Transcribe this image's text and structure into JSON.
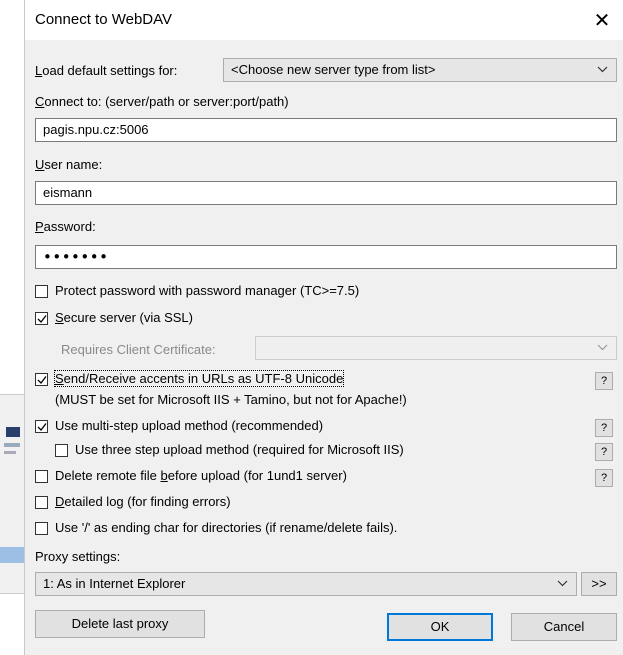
{
  "window": {
    "title": "Connect to WebDAV",
    "close_glyph": "✕"
  },
  "load_defaults": {
    "label_underlined": "L",
    "label_rest": "oad default settings for:",
    "value": "<Choose new server type from list>"
  },
  "connect": {
    "label_underlined": "C",
    "label_rest": "onnect to: (server/path or server:port/path)",
    "value": "pagis.npu.cz:5006"
  },
  "user": {
    "label_underlined": "U",
    "label_rest": "ser name:",
    "value": "eismann"
  },
  "password": {
    "label_underlined": "P",
    "label_rest": "assword:",
    "value": "•••••••"
  },
  "options": {
    "protect_password": {
      "label": "Protect password with password manager (TC>=7.5)",
      "checked": false
    },
    "secure_server": {
      "label_underlined": "S",
      "label_rest": "ecure server (via SSL)",
      "checked": true
    },
    "client_cert": {
      "label": "Requires Client Certificate:",
      "value": ""
    },
    "utf8": {
      "label_underlined": "S",
      "label_rest": "end/Receive accents in URLs as UTF-8 Unicode",
      "note": "(MUST be set for Microsoft IIS + Tamino, but not for Apache!)",
      "checked": true
    },
    "multistep": {
      "label": "Use multi-step upload method (recommended)",
      "checked": true
    },
    "threestep": {
      "label": "Use three step upload method (required for Microsoft IIS)",
      "checked": false
    },
    "delete_remote": {
      "label_pre": "Delete remote file ",
      "label_underlined": "b",
      "label_rest": "efore upload (for 1und1 server)",
      "checked": false
    },
    "detailed_log": {
      "label_underlined": "D",
      "label_rest": "etailed log (for finding errors)",
      "checked": false
    },
    "ending_char": {
      "label": "Use '/' as ending char for directories (if rename/delete fails).",
      "checked": false
    }
  },
  "help_button": "?",
  "proxy": {
    "label": "Proxy settings:",
    "value": "1: As in Internet Explorer",
    "more_button": ">>",
    "delete_button": "Delete last proxy"
  },
  "buttons": {
    "ok": "OK",
    "cancel": "Cancel"
  }
}
